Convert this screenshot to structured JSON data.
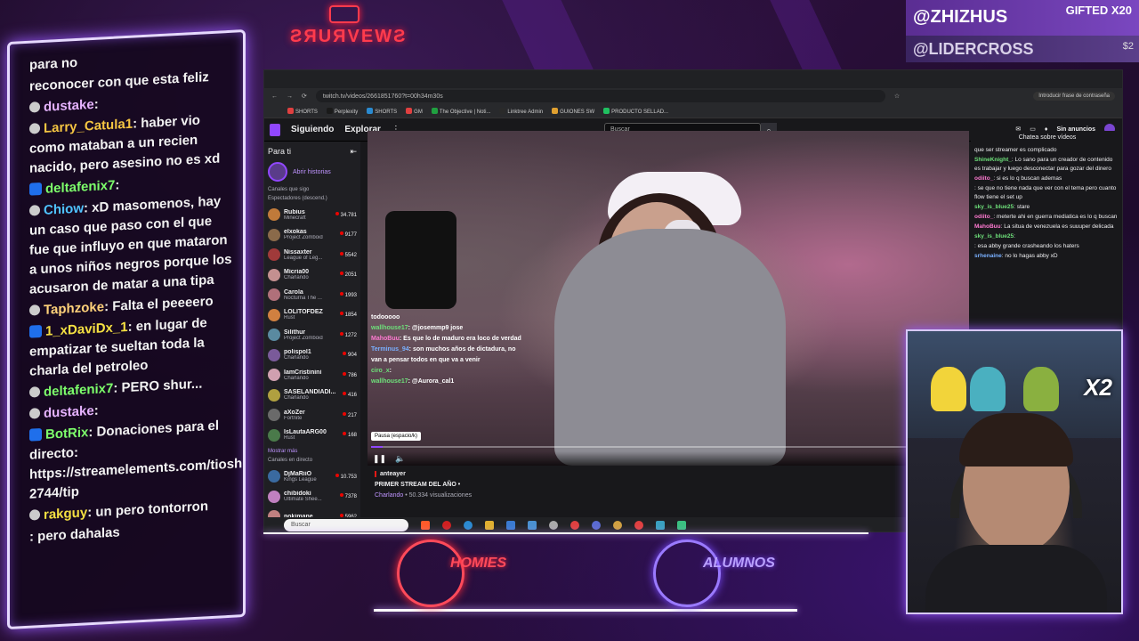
{
  "overlay": {
    "top_logo_text": "ƧЯUЯVEWƧ",
    "banner_top_name": "@ZHIZHUS",
    "banner_gifted": "GIFTED X20",
    "banner_second_name": "@LIDERCROSS",
    "banner_second_amount": "$2",
    "logo_homies": "HOMIES",
    "logo_alumnos": "ALUMNOS",
    "webcam_multiplier": "X2"
  },
  "left_chat": [
    {
      "user": "",
      "text": "para no",
      "user_color": "#ffffff"
    },
    {
      "user": "",
      "text": "reconocer con que esta feliz",
      "user_color": "#ffffff"
    },
    {
      "user": "dustake",
      "text": ":",
      "user_color": "#e6b3ff"
    },
    {
      "user": "Larry_Catula1",
      "text": ": haber vio como mataban a un recien nacido, pero asesino no es xd",
      "user_color": "#f5c542"
    },
    {
      "user": "deltafenix7",
      "text": ":",
      "user_color": "#7dff6b"
    },
    {
      "user": "Chiow",
      "text": ": xD masomenos, hay un caso que paso con el que fue que influyo en que mataron a unos niños negros porque los acusaron de matar a una tipa",
      "user_color": "#4fc3ff"
    },
    {
      "user": "Taphzoke",
      "text": ": Falta el peeeero",
      "user_color": "#ffd27a"
    },
    {
      "user": "1_xDaviDx_1",
      "text": ": en lugar de empatizar te sueltan toda la charla del petroleo",
      "user_color": "#f5e042"
    },
    {
      "user": "deltafenix7",
      "text": ": PERO shur...",
      "user_color": "#7dff6b"
    },
    {
      "user": "dustake",
      "text": ":",
      "user_color": "#e6b3ff"
    },
    {
      "user": "BotRix",
      "text": ": Donaciones para el directo: https://streamelements.com/tioshur-2744/tip",
      "user_color": "#7dff6b"
    },
    {
      "user": "rakguy",
      "text": ": un pero tontorron",
      "user_color": "#f5e042"
    },
    {
      "user": "",
      "text": ": pero dahalas",
      "user_color": "#ffffff"
    }
  ],
  "browser": {
    "url": "twitch.tv/videos/2661851760?t=00h34m30s",
    "password_prompt": "Introducir frase de contraseña",
    "bookmarks": [
      "SHORTS",
      "Perplexity",
      "SHORTS",
      "GM",
      "The Objective | Noti...",
      "Linktree Admin",
      "GUIONES SW",
      "PRODUCTO SELLAD..."
    ]
  },
  "twitch": {
    "nav_following": "Siguiendo",
    "nav_explore": "Explorar",
    "search_placeholder": "Buscar",
    "no_ads": "Sin anuncios",
    "sidebar_title": "Para ti",
    "stories_label": "Abrir historias",
    "followed_channels": "Canales que sigo",
    "sort_label": "Espectadores (descend.)",
    "show_more": "Mostrar más",
    "live_channels": "Canales en directo",
    "channels": [
      {
        "name": "Rubius",
        "game": "Minecraft",
        "viewers": "34.781",
        "color": "#c07a3a"
      },
      {
        "name": "elxokas",
        "game": "Project Zomboid",
        "viewers": "9177",
        "color": "#8a6a4a"
      },
      {
        "name": "Nissaxter",
        "game": "League of Leg...",
        "viewers": "5542",
        "color": "#a03a3a"
      },
      {
        "name": "Micria00",
        "game": "Charlando",
        "viewers": "2051",
        "color": "#c49090"
      },
      {
        "name": "Carola",
        "game": "Nocturna The ...",
        "viewers": "1993",
        "color": "#b0707a"
      },
      {
        "name": "LOLITOFDEZ",
        "game": "Rust",
        "viewers": "1854",
        "color": "#d08040"
      },
      {
        "name": "Silithur",
        "game": "Project Zomboid",
        "viewers": "1272",
        "color": "#5a8aa0"
      },
      {
        "name": "polispol1",
        "game": "Charlando",
        "viewers": "904",
        "color": "#7a5a9a"
      },
      {
        "name": "IamCristinini",
        "game": "Charlando",
        "viewers": "786",
        "color": "#d0a0b0"
      },
      {
        "name": "SASELANDIADI...",
        "game": "Charlando",
        "viewers": "416",
        "color": "#b0a040"
      },
      {
        "name": "aXoZer",
        "game": "Fortnite",
        "viewers": "217",
        "color": "#6a6a6a"
      },
      {
        "name": "IsLautaARG00",
        "game": "Rust",
        "viewers": "168",
        "color": "#4a7a4a"
      }
    ],
    "live_list": [
      {
        "name": "DjMaRiiO",
        "game": "Kings League",
        "viewers": "10.753",
        "color": "#3a6aa0"
      },
      {
        "name": "chibidoki",
        "game": "Ultimate Shee...",
        "viewers": "7378",
        "color": "#c080c0"
      },
      {
        "name": "pokimane",
        "game": "",
        "viewers": "5962",
        "color": "#c08080"
      }
    ],
    "video_overlay_chat": [
      {
        "user": "",
        "text": "todooooo",
        "color": "#ffffff"
      },
      {
        "user": "wallhouse17",
        "text": ": @josemmp9 jose",
        "color": "#6ee07a"
      },
      {
        "user": "MahoBuu",
        "text": ": Es que lo de maduro era loco de verdad",
        "color": "#ff7ad1"
      },
      {
        "user": "Terminus_94",
        "text": ": son muchos años de dictadura, no van a pensar todos en que va a venir",
        "color": "#7ab0ff"
      },
      {
        "user": "ciro_x",
        "text": ":",
        "color": "#6ee07a"
      },
      {
        "user": "wallhouse17",
        "text": ": @Aurora_cal1",
        "color": "#6ee07a"
      }
    ],
    "pause_tooltip": "Pausa (espacio/k)",
    "video_channel": "anteayer",
    "video_title": "PRIMER STREAM DEL AÑO •",
    "video_category": "Charlando",
    "video_views": "• 50.334 visualizaciones",
    "progress": 0.02,
    "chat_title": "Chatea sobre vídeos",
    "chat_messages": [
      {
        "user": "",
        "text": "que ser streamer es complicado",
        "color": "#ffffff"
      },
      {
        "user": "ShineKnight_",
        "text": ": Lo sano para un creador de contenido es trabajar y luego desconectar para gozar del dinero",
        "color": "#6ee07a"
      },
      {
        "user": "odiito_",
        "text": ": si es lo q buscan ademas",
        "color": "#ff7ad1"
      },
      {
        "user": "",
        "text": ": se que no tiene nada que ver con el tema pero cuanto flow tiene el set up",
        "color": "#ff4040"
      },
      {
        "user": "sky_is_blue25",
        "text": ": stare",
        "color": "#6ee07a"
      },
      {
        "user": "odiito_",
        "text": ": meterte ahi en guerra mediatica es lo q buscan",
        "color": "#ff7ad1"
      },
      {
        "user": "MahoBuu",
        "text": ": La situa de venezuela es suuuper delicada",
        "color": "#ff7ad1"
      },
      {
        "user": "sky_is_blue25",
        "text": ":",
        "color": "#6ee07a"
      },
      {
        "user": "",
        "text": ": esa abby grande crasheando los haters",
        "color": "#7a5aff"
      },
      {
        "user": "srhenaine",
        "text": ": no lo hagas abby xD",
        "color": "#7ab0ff"
      }
    ]
  },
  "taskbar": {
    "search_placeholder": "Buscar"
  }
}
